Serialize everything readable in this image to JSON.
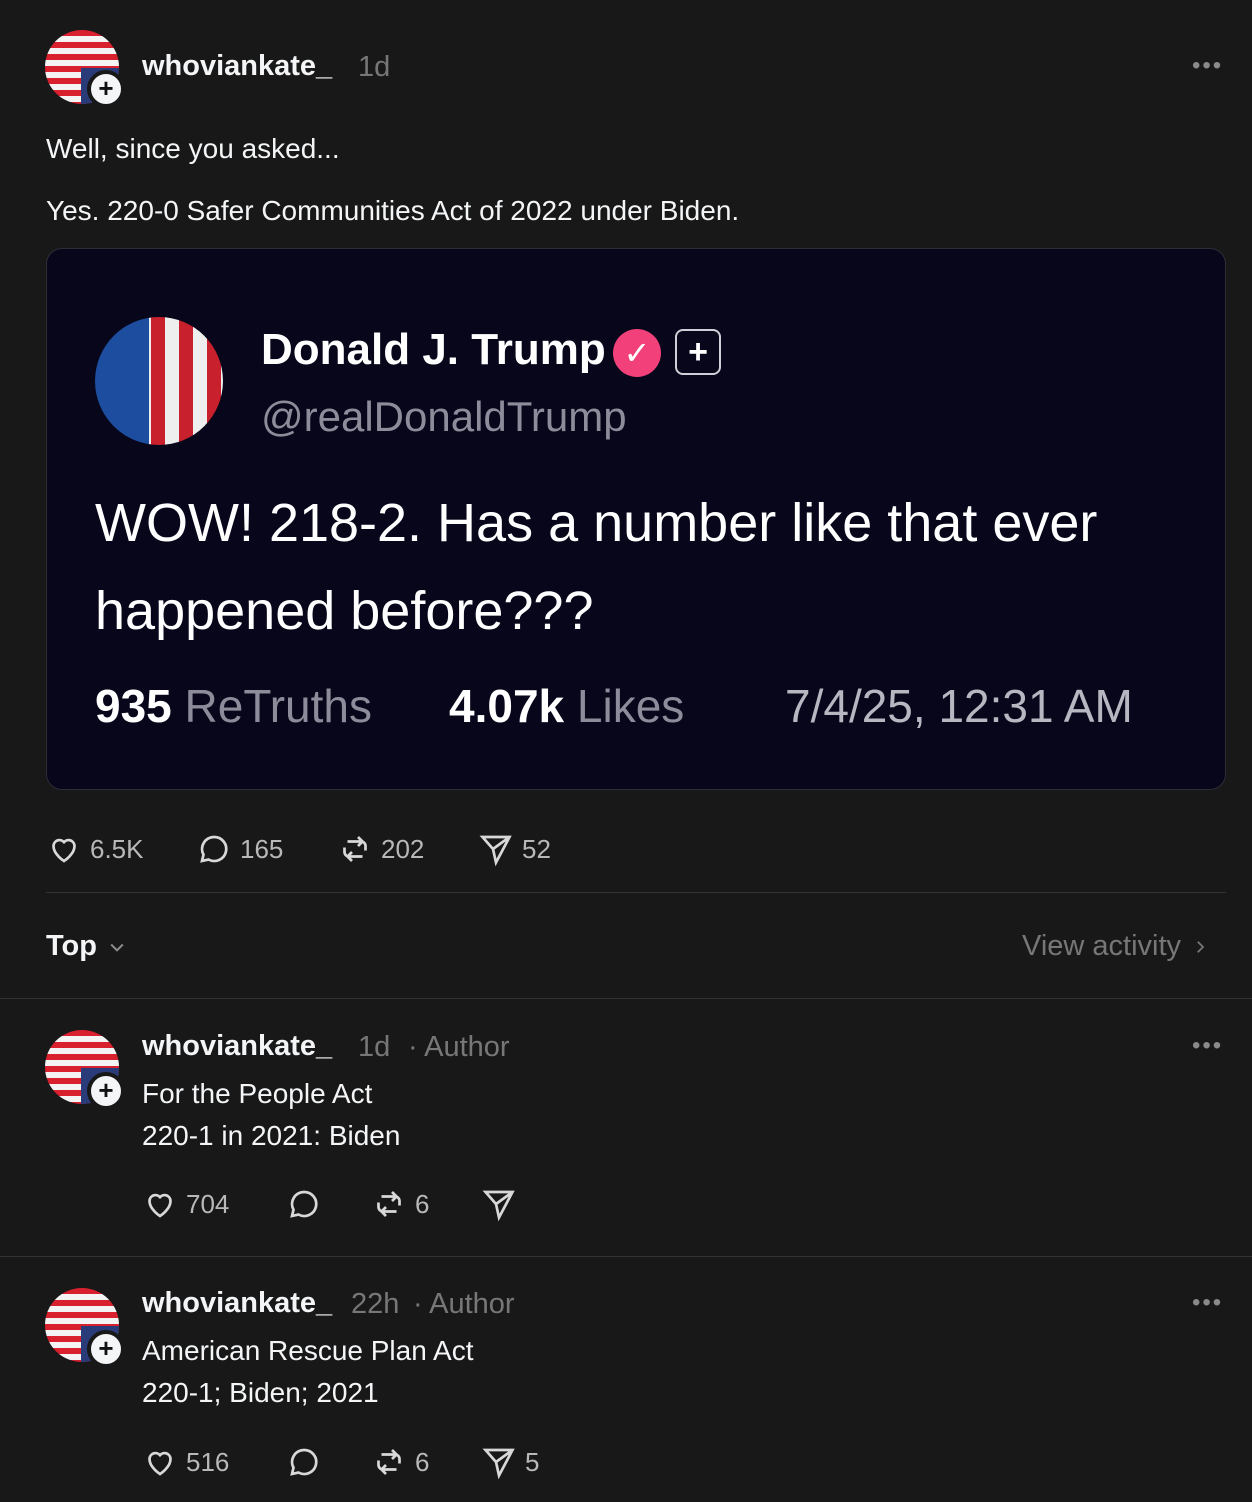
{
  "post": {
    "username": "whoviankate_",
    "time": "1d",
    "text_line1": "Well, since you asked...",
    "text_line2": "Yes. 220-0 Safer Communities Act of 2022 under Biden.",
    "more": "•••",
    "embed": {
      "name": "Donald J. Trump",
      "handle": "@realDonaldTrump",
      "text": "WOW! 218-2. Has a number like that ever happened before???",
      "retruths_count": "935",
      "retruths_label": "ReTruths",
      "likes_count": "4.07k",
      "likes_label": "Likes",
      "timestamp": "7/4/25, 12:31 AM"
    },
    "actions": {
      "likes": "6.5K",
      "replies": "165",
      "reposts": "202",
      "shares": "52"
    }
  },
  "sort": {
    "label": "Top",
    "view_activity": "View activity"
  },
  "replies": [
    {
      "username": "whoviankate_",
      "time": "1d",
      "role": "· Author",
      "line1": "For the People Act",
      "line2": "220-1 in 2021: Biden",
      "likes": "704",
      "reposts": "6",
      "shares": ""
    },
    {
      "username": "whoviankate_",
      "time": "22h",
      "role": "· Author",
      "line1": "American Rescue Plan Act",
      "line2": "220-1; Biden; 2021",
      "likes": "516",
      "reposts": "6",
      "shares": "5"
    }
  ],
  "icons": [
    "heart-icon",
    "comment-icon",
    "repost-icon",
    "share-icon",
    "more-icon",
    "chevron-down-icon",
    "chevron-right-icon",
    "plus-icon",
    "verified-icon"
  ]
}
